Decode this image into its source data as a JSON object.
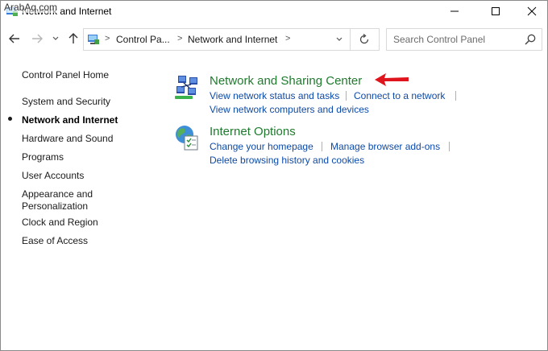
{
  "watermark": "ArabAq.com",
  "window": {
    "title": "Network and Internet"
  },
  "address": {
    "crumbs": [
      "Control Pa...",
      "Network and Internet"
    ]
  },
  "search": {
    "placeholder": "Search Control Panel"
  },
  "sidebar": {
    "home": "Control Panel Home",
    "items": [
      {
        "label": "System and Security"
      },
      {
        "label": "Network and Internet"
      },
      {
        "label": "Hardware and Sound"
      },
      {
        "label": "Programs"
      },
      {
        "label": "User Accounts"
      },
      {
        "label": "Appearance and"
      },
      {
        "label": "Personalization"
      },
      {
        "label": "Clock and Region"
      },
      {
        "label": "Ease of Access"
      }
    ]
  },
  "sections": [
    {
      "title": "Network and Sharing Center",
      "icon": "network-sharing-icon",
      "links": [
        "View network status and tasks",
        "Connect to a network",
        "View network computers and devices"
      ]
    },
    {
      "title": "Internet Options",
      "icon": "internet-options-icon",
      "links": [
        "Change your homepage",
        "Manage browser add-ons",
        "Delete browsing history and cookies"
      ]
    }
  ],
  "colors": {
    "section_title": "#1f7a2e",
    "link": "#0d4aa8",
    "annotation_arrow": "#e0141c"
  }
}
